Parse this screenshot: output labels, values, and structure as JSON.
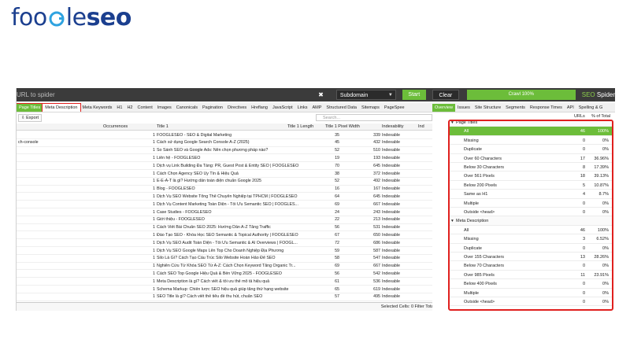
{
  "logo": {
    "part1": "foo",
    "part2": "le",
    "part3": "seo"
  },
  "topbar": {
    "url_placeholder": "URL to spider",
    "close_glyph": "✖",
    "mode": "Subdomain",
    "start": "Start",
    "clear": "Clear",
    "crawl": "Crawl 100%",
    "brand_a": "SEO",
    "brand_b": "Spider"
  },
  "left_tabs": [
    "Page Titles",
    "Meta Description",
    "Meta Keywords",
    "H1",
    "H2",
    "Content",
    "Images",
    "Canonicals",
    "Pagination",
    "Directives",
    "Hreflang",
    "JavaScript",
    "Links",
    "AMP",
    "Structured Data",
    "Sitemaps",
    "PageSpee"
  ],
  "toolbar": {
    "export": "Export",
    "search_placeholder": "Search..."
  },
  "columns": {
    "occurrences": "Occurrences",
    "title": "Title 1",
    "length": "Title 1 Length",
    "pixel": "Title 1 Pixel Width",
    "indexability": "Indexability",
    "ind": "Ind"
  },
  "rows": [
    {
      "addr": "",
      "occ": "1",
      "title": "FOOGLESEO - SEO & Digital Marketing",
      "len": "35",
      "px": "339",
      "idx": "Indexable"
    },
    {
      "addr": "ch-console",
      "occ": "1",
      "title": "Cách sử dụng Google Search Console A-Z (2025)",
      "len": "45",
      "px": "432",
      "idx": "Indexable"
    },
    {
      "addr": "",
      "occ": "1",
      "title": "So Sánh SEO và Google Ads: Nên chọn phương pháp nào?",
      "len": "52",
      "px": "510",
      "idx": "Indexable"
    },
    {
      "addr": "",
      "occ": "1",
      "title": "Liên hệ - FOOGLESEO",
      "len": "19",
      "px": "193",
      "idx": "Indexable"
    },
    {
      "addr": "",
      "occ": "1",
      "title": "Dịch vụ Link Building Đa Tầng: PR, Guest Post & Entity SEO | FOOGLESEO",
      "len": "70",
      "px": "645",
      "idx": "Indexable"
    },
    {
      "addr": "",
      "occ": "1",
      "title": "Cách Chọn Agency SEO Uy Tín & Hiệu Quả",
      "len": "38",
      "px": "372",
      "idx": "Indexable"
    },
    {
      "addr": "",
      "occ": "1",
      "title": "E-E-A-T là gì? Hướng dẫn toàn diện chuẩn Google 2025",
      "len": "52",
      "px": "492",
      "idx": "Indexable"
    },
    {
      "addr": "",
      "occ": "1",
      "title": "Blog - FOOGLESEO",
      "len": "16",
      "px": "167",
      "idx": "Indexable"
    },
    {
      "addr": "",
      "occ": "1",
      "title": "Dịch Vụ SEO Website Tổng Thể Chuyên Nghiệp tại TPHCM | FOOGLESEO",
      "len": "64",
      "px": "645",
      "idx": "Indexable"
    },
    {
      "addr": "",
      "occ": "1",
      "title": "Dịch Vụ Content Marketing Toàn Diện - Tối Ưu Semantic SEO | FOOGLES...",
      "len": "69",
      "px": "667",
      "idx": "Indexable"
    },
    {
      "addr": "",
      "occ": "1",
      "title": "Case Studies - FOOGLESEO",
      "len": "24",
      "px": "243",
      "idx": "Indexable"
    },
    {
      "addr": "",
      "occ": "1",
      "title": "Giới thiệu - FOOGLESEO",
      "len": "22",
      "px": "213",
      "idx": "Indexable"
    },
    {
      "addr": "",
      "occ": "1",
      "title": "Cách Viết Bài Chuẩn SEO 2025: Hướng Dẫn A-Z Tăng Traffic",
      "len": "56",
      "px": "531",
      "idx": "Indexable"
    },
    {
      "addr": "",
      "occ": "1",
      "title": "Đào Tạo SEO - Khóa Học SEO Semantic & Topical Authority | FOOGLESEO",
      "len": "67",
      "px": "650",
      "idx": "Indexable"
    },
    {
      "addr": "",
      "occ": "1",
      "title": "Dịch Vụ SEO Audit Toàn Diện - Tối Ưu Semantic & AI Overviews | FOOGL...",
      "len": "72",
      "px": "686",
      "idx": "Indexable"
    },
    {
      "addr": "",
      "occ": "1",
      "title": "Dịch Vụ SEO Google Maps Lên Top Cho Doanh Nghiệp Địa Phương",
      "len": "59",
      "px": "587",
      "idx": "Indexable"
    },
    {
      "addr": "",
      "occ": "1",
      "title": "Silo Là Gì? Cách Tạo Cấu Trúc Silo Website Hoàn Hảo Để SEO",
      "len": "58",
      "px": "547",
      "idx": "Indexable"
    },
    {
      "addr": "",
      "occ": "1",
      "title": "Nghiên Cứu Từ Khóa SEO Từ A-Z: Cách Chọn Keyword Tăng Organic Tr...",
      "len": "69",
      "px": "667",
      "idx": "Indexable"
    },
    {
      "addr": "",
      "occ": "1",
      "title": "Cách SEO Top Google Hiệu Quả & Bền Vững 2025 - FOOGLESEO",
      "len": "56",
      "px": "542",
      "idx": "Indexable"
    },
    {
      "addr": "",
      "occ": "1",
      "title": "Meta Description là gì? Cách viết & tối ưu thẻ mô tả hiệu quả",
      "len": "61",
      "px": "536",
      "idx": "Indexable"
    },
    {
      "addr": "",
      "occ": "1",
      "title": "Schema Markup: Chiến lược SEO hiệu quả giúp tăng thứ hạng website",
      "len": "65",
      "px": "619",
      "idx": "Indexable"
    },
    {
      "addr": "",
      "occ": "1",
      "title": "SEO Title là gì? Cách viết thẻ tiêu đề thu hút, chuẩn SEO",
      "len": "57",
      "px": "495",
      "idx": "Indexable"
    },
    {
      "addr": "",
      "occ": "1",
      "title": "Internal Link là gì? Cách xây dựng liên kết nội bộ chuẩn SEO hiệu quả",
      "len": "",
      "px": "",
      "idx": "Indexable"
    }
  ],
  "status": {
    "text": "Selected Cells: 0  Filter Total: 46"
  },
  "right_tabs": [
    "Overview",
    "Issues",
    "Site Structure",
    "Segments",
    "Response Times",
    "API",
    "Spelling & G"
  ],
  "right_header": {
    "urls": "URLs",
    "pct": "% of Total"
  },
  "overview": [
    {
      "label": "Page Titles",
      "count": "",
      "pct": "",
      "type": "section"
    },
    {
      "label": "All",
      "count": "46",
      "pct": "100%",
      "type": "hl"
    },
    {
      "label": "Missing",
      "count": "0",
      "pct": "0%",
      "type": "item"
    },
    {
      "label": "Duplicate",
      "count": "0",
      "pct": "0%",
      "type": "item"
    },
    {
      "label": "Over 60 Characters",
      "count": "17",
      "pct": "36.96%",
      "type": "item"
    },
    {
      "label": "Below 30 Characters",
      "count": "8",
      "pct": "17.39%",
      "type": "item"
    },
    {
      "label": "Over 561 Pixels",
      "count": "18",
      "pct": "39.13%",
      "type": "item"
    },
    {
      "label": "Below 200 Pixels",
      "count": "5",
      "pct": "10.87%",
      "type": "item"
    },
    {
      "label": "Same as H1",
      "count": "4",
      "pct": "8.7%",
      "type": "item"
    },
    {
      "label": "Multiple",
      "count": "0",
      "pct": "0%",
      "type": "item"
    },
    {
      "label": "Outside <head>",
      "count": "0",
      "pct": "0%",
      "type": "item"
    },
    {
      "label": "Meta Description",
      "count": "",
      "pct": "",
      "type": "section"
    },
    {
      "label": "All",
      "count": "46",
      "pct": "100%",
      "type": "item"
    },
    {
      "label": "Missing",
      "count": "3",
      "pct": "6.52%",
      "type": "item"
    },
    {
      "label": "Duplicate",
      "count": "0",
      "pct": "0%",
      "type": "item"
    },
    {
      "label": "Over 155 Characters",
      "count": "13",
      "pct": "28.26%",
      "type": "item"
    },
    {
      "label": "Below 70 Characters",
      "count": "0",
      "pct": "0%",
      "type": "item"
    },
    {
      "label": "Over 985 Pixels",
      "count": "11",
      "pct": "23.91%",
      "type": "item"
    },
    {
      "label": "Below 400 Pixels",
      "count": "0",
      "pct": "0%",
      "type": "item"
    },
    {
      "label": "Multiple",
      "count": "0",
      "pct": "0%",
      "type": "item"
    },
    {
      "label": "Outside <head>",
      "count": "0",
      "pct": "0%",
      "type": "item"
    }
  ]
}
